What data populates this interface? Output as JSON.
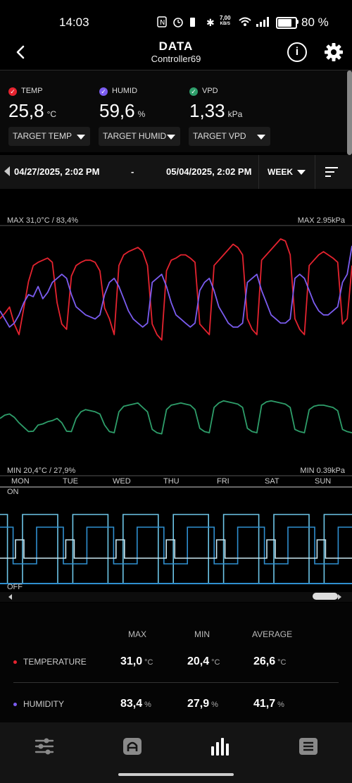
{
  "status_bar": {
    "time": "14:03",
    "net_speed_value": "7,00",
    "net_speed_unit": "KB/S",
    "battery": "80 %"
  },
  "header": {
    "title": "DATA",
    "subtitle": "Controller69"
  },
  "metrics": [
    {
      "label": "TEMP",
      "value": "25,8",
      "unit": "°C",
      "color": "#e5232f",
      "target": "TARGET TEMP"
    },
    {
      "label": "HUMID",
      "value": "59,6",
      "unit": "%",
      "color": "#7b5cf0",
      "target": "TARGET HUMID"
    },
    {
      "label": "VPD",
      "value": "1,33",
      "unit": "kPa",
      "color": "#2e9e6a",
      "target": "TARGET VPD"
    }
  ],
  "date_range": {
    "start": "04/27/2025, 2:02 PM",
    "separator": "-",
    "end": "05/04/2025, 2:02 PM",
    "range": "WEEK"
  },
  "chart_data": {
    "type": "line",
    "x_labels": [
      "MON",
      "TUE",
      "WED",
      "THU",
      "FRI",
      "SAT",
      "SUN"
    ],
    "max_left": "MAX 31,0°C / 83,4%",
    "max_right": "MAX 2.95kPa",
    "min_left": "MIN 20,4°C / 27,9%",
    "min_right": "MIN 0.39kPa",
    "ylim_temp": [
      20.4,
      31.0
    ],
    "ylim_humid": [
      27.9,
      83.4
    ],
    "ylim_vpd": [
      0.39,
      2.95
    ],
    "series": [
      {
        "name": "TEMPERATURE",
        "color": "#e5232f",
        "y": [
          23.5,
          24.0,
          24.6,
          23.0,
          22.0,
          24.5,
          27.0,
          28.5,
          28.8,
          29.0,
          29.2,
          28.8,
          25.0,
          23.0,
          22.5,
          27.5,
          28.5,
          28.8,
          29.0,
          29.0,
          28.8,
          28.0,
          24.5,
          23.5,
          22.0,
          28.5,
          29.5,
          29.8,
          30.0,
          30.2,
          29.8,
          28.5,
          23.0,
          22.0,
          21.5,
          28.0,
          29.0,
          29.2,
          29.5,
          29.5,
          29.2,
          28.8,
          23.0,
          22.5,
          22.0,
          28.5,
          29.0,
          29.5,
          30.0,
          30.5,
          30.2,
          29.5,
          23.5,
          22.5,
          22.0,
          29.0,
          29.5,
          30.0,
          30.5,
          31.0,
          30.8,
          29.5,
          23.5,
          22.5,
          22.0,
          28.5,
          29.0,
          29.5,
          29.8,
          29.5,
          29.2,
          28.8,
          23.0,
          23.5,
          28.5
        ]
      },
      {
        "name": "HUMIDITY",
        "color": "#7b5cf0",
        "y": [
          48,
          44,
          40,
          42,
          46,
          52,
          56,
          55,
          60,
          54,
          57,
          62,
          64,
          66,
          64,
          56,
          50,
          48,
          46,
          45,
          44,
          46,
          56,
          62,
          64,
          60,
          54,
          48,
          44,
          42,
          40,
          42,
          62,
          64,
          66,
          60,
          52,
          46,
          44,
          42,
          40,
          42,
          58,
          62,
          64,
          58,
          50,
          46,
          42,
          40,
          40,
          42,
          62,
          64,
          66,
          58,
          52,
          46,
          44,
          42,
          42,
          44,
          64,
          66,
          64,
          58,
          52,
          48,
          46,
          46,
          48,
          50,
          62,
          66,
          80
        ]
      },
      {
        "name": "VPD",
        "color": "#2e9e6a",
        "y": [
          1.2,
          1.35,
          1.4,
          1.25,
          1.0,
          0.8,
          0.6,
          0.62,
          0.9,
          0.95,
          1.05,
          1.1,
          1.2,
          1.0,
          0.62,
          0.6,
          1.2,
          1.5,
          1.6,
          1.55,
          1.5,
          1.4,
          0.9,
          0.6,
          0.55,
          1.5,
          1.75,
          1.8,
          1.85,
          1.9,
          1.7,
          1.5,
          0.7,
          0.55,
          0.5,
          1.6,
          1.8,
          1.85,
          1.9,
          1.85,
          1.8,
          1.6,
          0.75,
          0.6,
          0.55,
          1.7,
          1.9,
          2.0,
          1.95,
          1.9,
          1.85,
          1.7,
          0.75,
          0.6,
          0.55,
          1.8,
          1.95,
          2.0,
          1.95,
          1.9,
          1.85,
          1.7,
          0.7,
          0.6,
          0.55,
          1.6,
          1.75,
          1.8,
          1.8,
          1.75,
          1.7,
          1.55,
          0.7,
          0.6,
          0.55
        ]
      }
    ],
    "device_on_label": "ON",
    "device_off_label": "OFF"
  },
  "stats": {
    "headers": {
      "max": "MAX",
      "min": "MIN",
      "avg": "AVERAGE"
    },
    "rows": [
      {
        "label": "TEMPERATURE",
        "color": "#e5232f",
        "max": "31,0",
        "min": "20,4",
        "avg": "26,6",
        "unit": "°C"
      },
      {
        "label": "HUMIDITY",
        "color": "#7b5cf0",
        "max": "83,4",
        "min": "27,9",
        "avg": "41,7",
        "unit": "%"
      }
    ]
  },
  "nav": {
    "icons": [
      "sliders-icon",
      "controller-icon",
      "bar-chart-icon",
      "list-icon"
    ],
    "accent": "#ffffff",
    "muted": "#8a8a8a"
  }
}
